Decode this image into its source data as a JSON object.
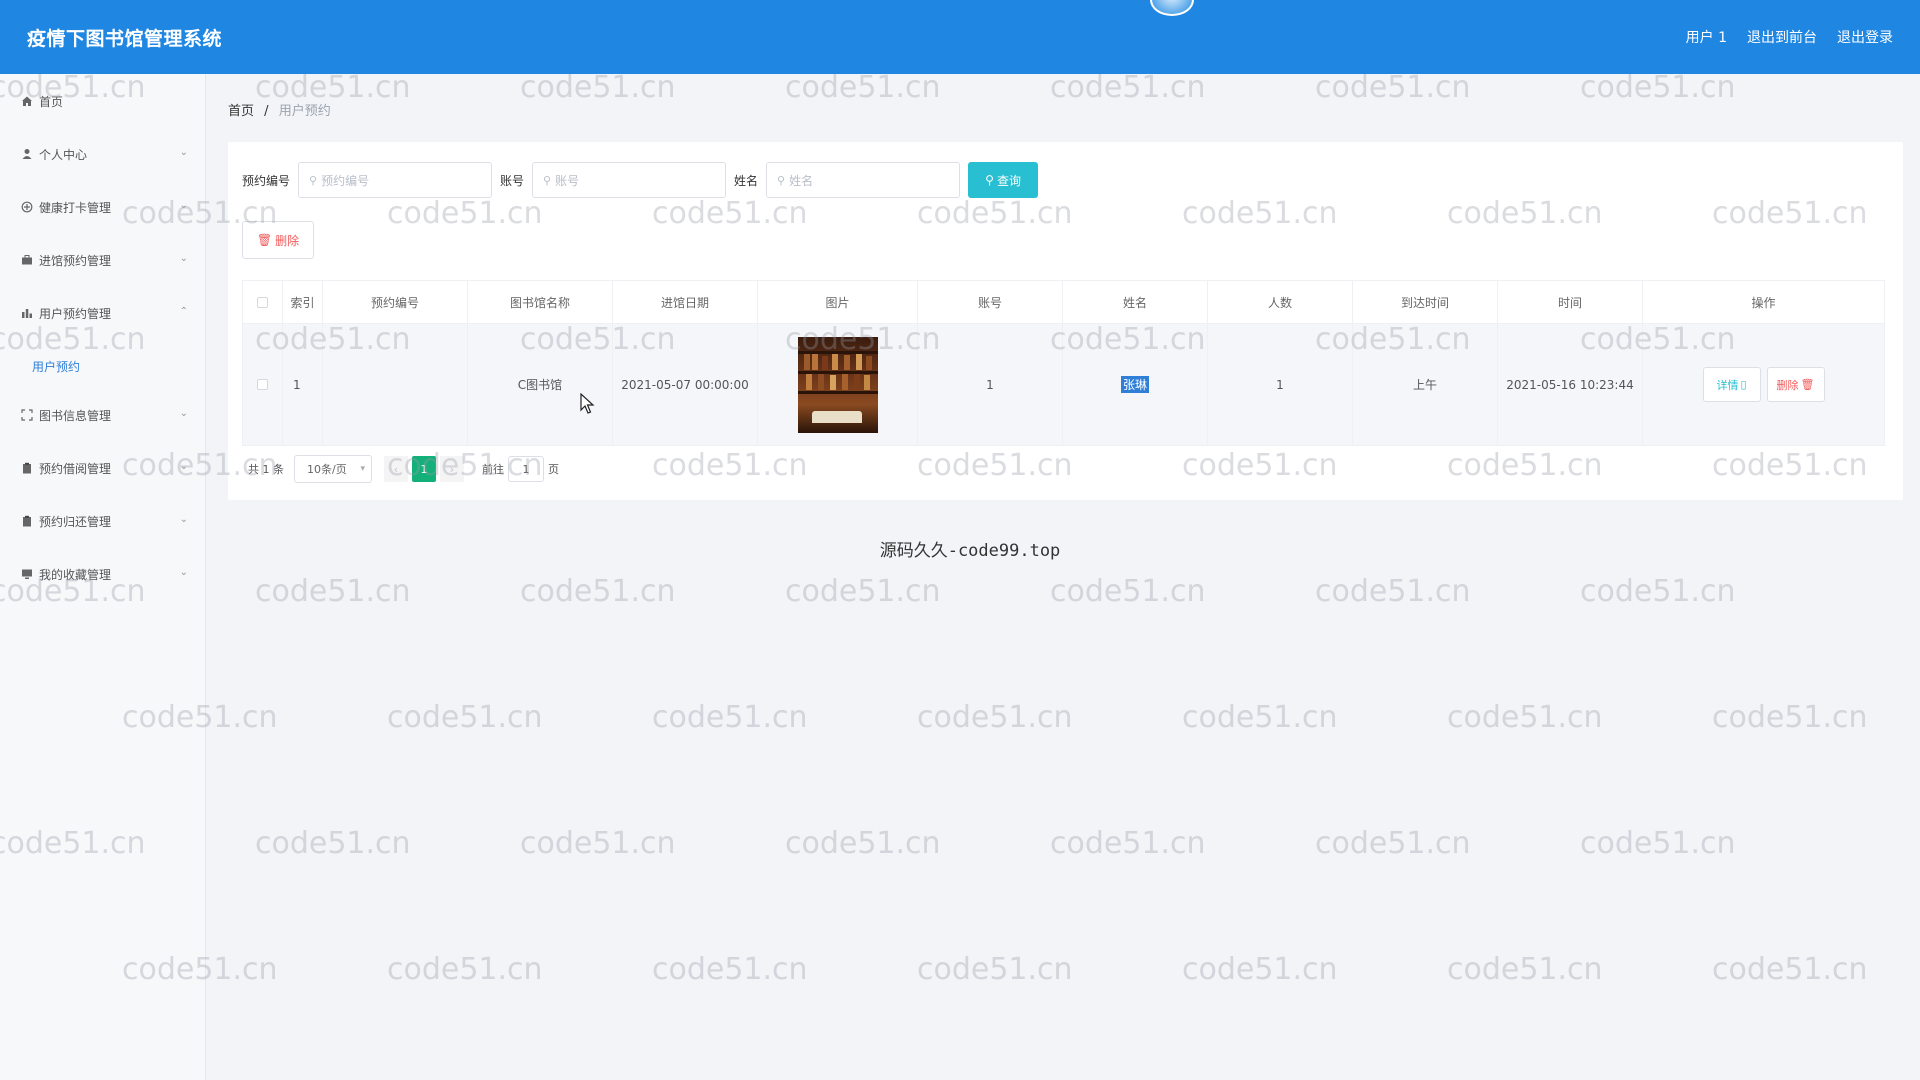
{
  "header": {
    "title": "疫情下图书馆管理系统",
    "user": "用户 1",
    "back_to_front": "退出到前台",
    "logout": "退出登录"
  },
  "sidebar": {
    "items": [
      {
        "label": "首页",
        "icon": "home-icon",
        "has_arrow": false
      },
      {
        "label": "个人中心",
        "icon": "user-icon",
        "has_arrow": true
      },
      {
        "label": "健康打卡管理",
        "icon": "health-icon",
        "has_arrow": true
      },
      {
        "label": "进馆预约管理",
        "icon": "briefcase-icon",
        "has_arrow": true
      },
      {
        "label": "用户预约管理",
        "icon": "bar-chart-icon",
        "has_arrow": true,
        "expanded": true
      },
      {
        "label": "图书信息管理",
        "icon": "frame-icon",
        "has_arrow": true
      },
      {
        "label": "预约借阅管理",
        "icon": "clipboard-icon",
        "has_arrow": true
      },
      {
        "label": "预约归还管理",
        "icon": "clipboard-icon",
        "has_arrow": true
      },
      {
        "label": "我的收藏管理",
        "icon": "monitor-icon",
        "has_arrow": true
      }
    ],
    "submenu": {
      "label": "用户预约"
    }
  },
  "breadcrumb": {
    "home": "首页",
    "separator": "/",
    "current": "用户预约"
  },
  "search": {
    "fields": [
      {
        "label": "预约编号",
        "placeholder": "预约编号"
      },
      {
        "label": "账号",
        "placeholder": "账号"
      },
      {
        "label": "姓名",
        "placeholder": "姓名"
      }
    ],
    "query_button": "查询"
  },
  "toolbar": {
    "delete_button": "删除"
  },
  "table": {
    "headers": [
      "索引",
      "预约编号",
      "图书馆名称",
      "进馆日期",
      "图片",
      "账号",
      "姓名",
      "人数",
      "到达时间",
      "时间",
      "操作"
    ],
    "rows": [
      {
        "index": "1",
        "reservation_no": "",
        "library_name": "C图书馆",
        "entry_date": "2021-05-07 00:00:00",
        "image": "library-bookshelf-photo",
        "account": "1",
        "name": "张琳",
        "people": "1",
        "arrival": "上午",
        "time": "2021-05-16 10:23:44",
        "detail_label": "详情",
        "delete_label": "删除"
      }
    ]
  },
  "pagination": {
    "total": "共 1 条",
    "page_size": "10条/页",
    "current_page": "1",
    "goto_label": "前往",
    "goto_value": "1",
    "page_suffix": "页"
  },
  "footer": {
    "text": "源码久久-code99.top"
  },
  "watermark": {
    "text": "code51.cn"
  },
  "colors": {
    "header_bg": "#1f86e2",
    "query_button": "#27bfd1",
    "delete_text": "#f15b5b",
    "current_page": "#14b07a",
    "submenu_active": "#2f7fd8"
  }
}
